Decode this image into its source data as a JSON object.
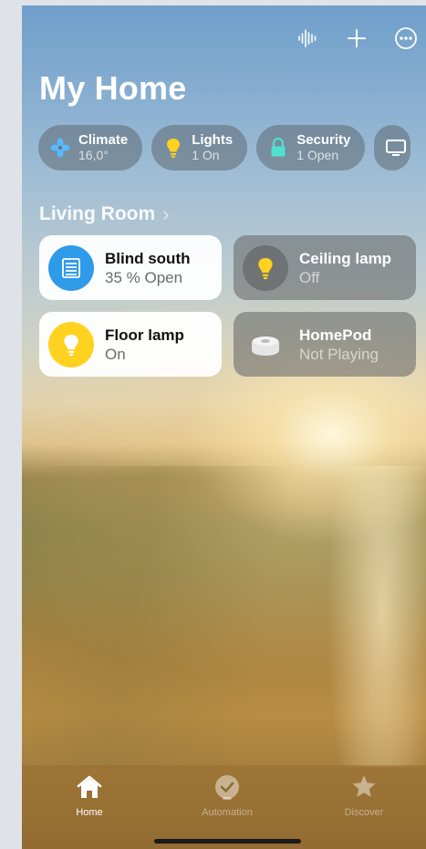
{
  "app": {
    "title": "My Home"
  },
  "top_icons": [
    "voice-waveform-icon",
    "plus-icon",
    "more-icon"
  ],
  "categories": [
    {
      "label": "Climate",
      "status": "16,0°",
      "icon": "fan-icon",
      "color": "#59b8ff"
    },
    {
      "label": "Lights",
      "status": "1 On",
      "icon": "bulb-icon",
      "color": "#ffd21f"
    },
    {
      "label": "Security",
      "status": "1 Open",
      "icon": "lock-icon",
      "color": "#4fe0d0"
    },
    {
      "label": "",
      "status": "",
      "icon": "tv-icon",
      "color": "#ffffff"
    }
  ],
  "section": {
    "title": "Living Room"
  },
  "accessories": [
    {
      "name": "Blind south",
      "state": "35 % Open",
      "on": true,
      "icon": "blind-icon",
      "color": "#2f9be8"
    },
    {
      "name": "Ceiling lamp",
      "state": "Off",
      "on": false,
      "icon": "bulb-icon",
      "color": "#ffd21f"
    },
    {
      "name": "Floor lamp",
      "state": "On",
      "on": true,
      "icon": "bulb-icon",
      "color": "#ffd21f"
    },
    {
      "name": "HomePod",
      "state": "Not Playing",
      "on": false,
      "icon": "homepod-icon",
      "color": "#e6e6e6"
    }
  ],
  "tabs": [
    {
      "label": "Home",
      "active": true,
      "icon": "house-icon"
    },
    {
      "label": "Automation",
      "active": false,
      "icon": "clock-check-icon"
    },
    {
      "label": "Discover",
      "active": false,
      "icon": "star-icon"
    }
  ]
}
